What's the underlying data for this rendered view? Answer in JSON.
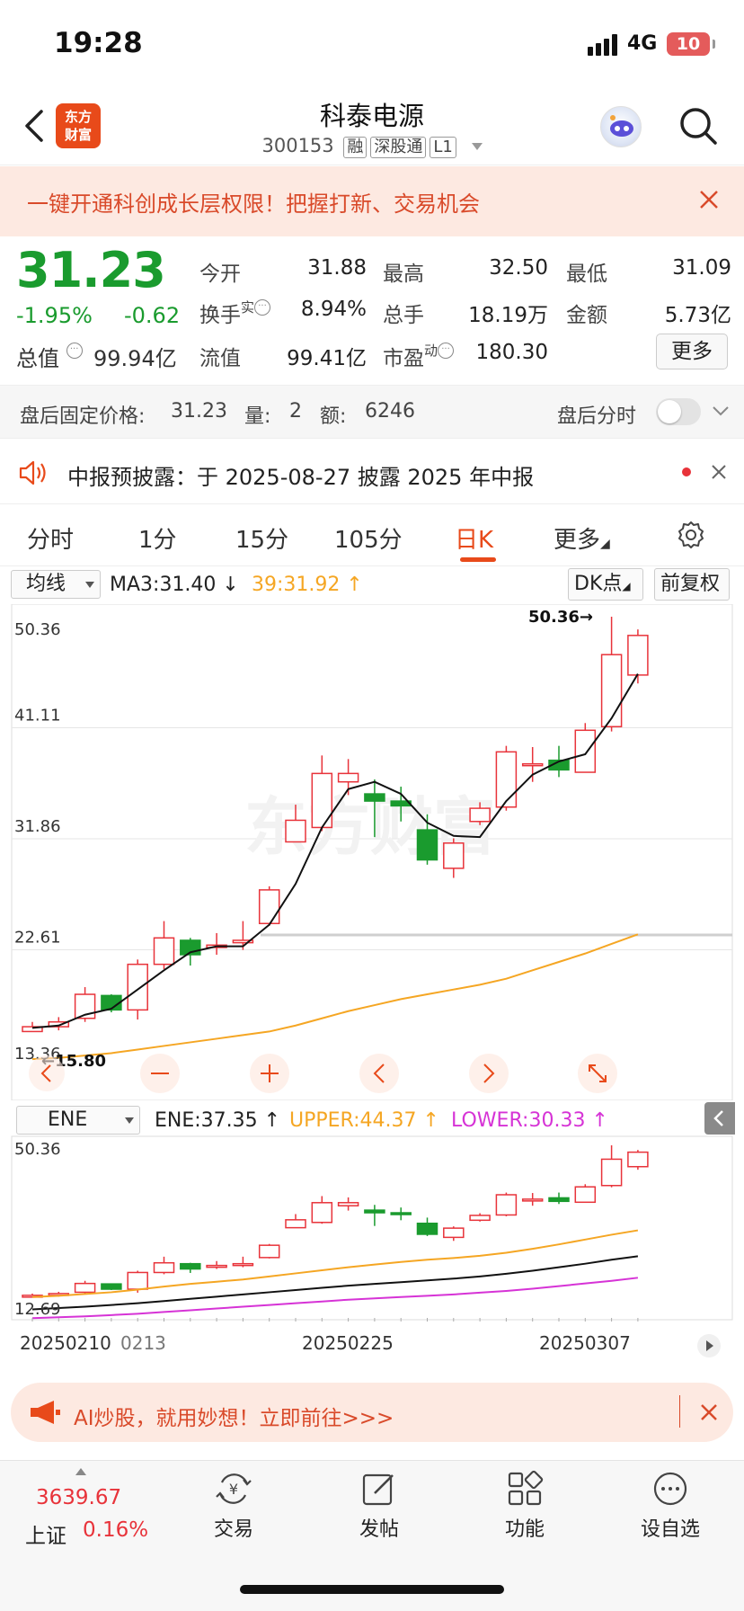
{
  "status_bar": {
    "time": "19:28",
    "network": "4G",
    "battery": "10"
  },
  "header": {
    "stock_name": "科泰电源",
    "stock_code": "300153",
    "tags": [
      "融",
      "深股通",
      "L1"
    ],
    "brand_logo": [
      "东方",
      "财富"
    ]
  },
  "promo": {
    "text": "一键开通科创成长层权限！把握打新、交易机会"
  },
  "quote": {
    "price": "31.23",
    "change_pct": "-1.95%",
    "change_amt": "-0.62",
    "market_cap_label": "总值",
    "market_cap_value": "99.94亿",
    "fields": {
      "open_label": "今开",
      "open": "31.88",
      "high_label": "最高",
      "high": "32.50",
      "low_label": "最低",
      "low": "31.09",
      "turnover_label": "换手",
      "turnover_sup": "实",
      "turnover": "8.94%",
      "volume_label": "总手",
      "volume": "18.19万",
      "amount_label": "金额",
      "amount": "5.73亿",
      "float_cap_label": "流值",
      "float_cap": "99.41亿",
      "pe_label": "市盈",
      "pe_sup": "动",
      "pe": "180.30"
    },
    "more_label": "更多"
  },
  "after_hours": {
    "label": "盘后固定价格:",
    "price": "31.23",
    "vol_label": "量:",
    "vol": "2",
    "amt_label": "额:",
    "amt": "6246",
    "toggle_label": "盘后分时"
  },
  "announcement": {
    "text": "中报预披露：于 2025-08-27 披露 2025 年中报"
  },
  "tabs": [
    "分时",
    "1分",
    "15分",
    "105分",
    "日K",
    "更多"
  ],
  "chart_header": {
    "indicator_select": "均线",
    "ma3": "MA3:31.40",
    "ma39": "39:31.92",
    "dk_button": "DK点",
    "adjust_button": "前复权"
  },
  "ene_header": {
    "select": "ENE",
    "ene": "ENE:37.35",
    "upper": "UPPER:44.37",
    "lower": "LOWER:30.33"
  },
  "colors": {
    "up": "#e8333a",
    "down": "#1a9b2e",
    "ma_long": "#f5a623",
    "ma_short": "#111111",
    "lower": "#d633d6",
    "accent": "#e84a1a"
  },
  "chart_data": {
    "type": "candlestick",
    "y_ticks": [
      "50.36",
      "41.11",
      "31.86",
      "22.61",
      "13.36"
    ],
    "ylim": [
      13.36,
      50.36
    ],
    "high_marker": "50.36",
    "low_marker": "15.80",
    "x_ticks": [
      "20250210",
      "0213",
      "20250225",
      "20250307"
    ],
    "candles": [
      {
        "o": 15.8,
        "c": 16.2,
        "h": 16.6,
        "l": 15.8
      },
      {
        "o": 16.2,
        "c": 16.6,
        "h": 17.0,
        "l": 15.9
      },
      {
        "o": 16.9,
        "c": 18.9,
        "h": 19.5,
        "l": 16.6
      },
      {
        "o": 18.8,
        "c": 17.6,
        "h": 18.9,
        "l": 17.4
      },
      {
        "o": 17.6,
        "c": 21.4,
        "h": 21.8,
        "l": 16.8
      },
      {
        "o": 21.4,
        "c": 23.6,
        "h": 25.0,
        "l": 21.0
      },
      {
        "o": 23.4,
        "c": 22.2,
        "h": 23.6,
        "l": 21.3
      },
      {
        "o": 22.8,
        "c": 23.0,
        "h": 24.0,
        "l": 22.2
      },
      {
        "o": 23.2,
        "c": 23.4,
        "h": 25.0,
        "l": 22.6
      },
      {
        "o": 24.8,
        "c": 27.6,
        "h": 27.9,
        "l": 24.6
      },
      {
        "o": 31.6,
        "c": 33.4,
        "h": 34.7,
        "l": 31.6
      },
      {
        "o": 32.8,
        "c": 37.3,
        "h": 38.8,
        "l": 32.5
      },
      {
        "o": 36.6,
        "c": 37.3,
        "h": 38.5,
        "l": 35.5
      },
      {
        "o": 35.6,
        "c": 35.0,
        "h": 36.8,
        "l": 32.0
      },
      {
        "o": 35.0,
        "c": 34.6,
        "h": 36.2,
        "l": 33.3
      },
      {
        "o": 32.6,
        "c": 30.1,
        "h": 33.9,
        "l": 29.7
      },
      {
        "o": 29.4,
        "c": 31.5,
        "h": 31.9,
        "l": 28.6
      },
      {
        "o": 33.3,
        "c": 34.4,
        "h": 34.9,
        "l": 33.0
      },
      {
        "o": 34.5,
        "c": 39.1,
        "h": 39.6,
        "l": 34.2
      },
      {
        "o": 38.0,
        "c": 38.1,
        "h": 39.5,
        "l": 36.6
      },
      {
        "o": 38.4,
        "c": 37.6,
        "h": 39.6,
        "l": 37.0
      },
      {
        "o": 37.4,
        "c": 40.9,
        "h": 41.5,
        "l": 37.4
      },
      {
        "o": 41.2,
        "c": 47.2,
        "h": 50.36,
        "l": 40.8
      },
      {
        "o": 45.5,
        "c": 48.8,
        "h": 49.3,
        "l": 44.8
      }
    ],
    "ma3": [
      16.1,
      16.3,
      17.2,
      17.7,
      19.3,
      20.9,
      22.4,
      22.9,
      22.9,
      24.7,
      28.1,
      32.8,
      36.0,
      36.6,
      35.6,
      33.2,
      32.1,
      32.0,
      35.0,
      37.2,
      38.3,
      38.9,
      41.9,
      45.6
    ],
    "ma39": [
      13.5,
      13.6,
      13.8,
      14.0,
      14.3,
      14.6,
      14.9,
      15.2,
      15.5,
      15.8,
      16.3,
      16.9,
      17.5,
      18.0,
      18.5,
      18.9,
      19.3,
      19.7,
      20.2,
      20.9,
      21.6,
      22.3,
      23.1,
      23.9
    ],
    "ene": {
      "ylim": [
        12.69,
        50.36
      ],
      "upper": [
        15.8,
        16.1,
        16.5,
        16.9,
        17.5,
        18.2,
        18.8,
        19.3,
        19.8,
        20.5,
        21.2,
        21.9,
        22.6,
        23.2,
        23.8,
        24.3,
        24.7,
        25.2,
        25.9,
        26.8,
        27.8,
        28.9,
        30.0,
        31.0
      ],
      "middle": [
        13.0,
        13.3,
        13.6,
        14.0,
        14.4,
        14.9,
        15.4,
        15.9,
        16.4,
        16.9,
        17.4,
        17.9,
        18.4,
        18.8,
        19.2,
        19.6,
        20.0,
        20.5,
        21.1,
        21.8,
        22.6,
        23.4,
        24.3,
        25.1
      ],
      "lower": [
        11.0,
        11.2,
        11.4,
        11.7,
        12.0,
        12.4,
        12.8,
        13.2,
        13.6,
        14.0,
        14.4,
        14.8,
        15.2,
        15.5,
        15.8,
        16.1,
        16.4,
        16.8,
        17.2,
        17.7,
        18.3,
        18.9,
        19.5,
        20.2
      ]
    }
  },
  "bottom_nav": {
    "index_value": "3639.67",
    "index_name": "上证",
    "index_pct": "0.16%",
    "items": [
      "交易",
      "发帖",
      "功能",
      "设自选"
    ]
  },
  "ai_banner": {
    "text": "AI炒股，就用妙想！立即前往>>>"
  }
}
